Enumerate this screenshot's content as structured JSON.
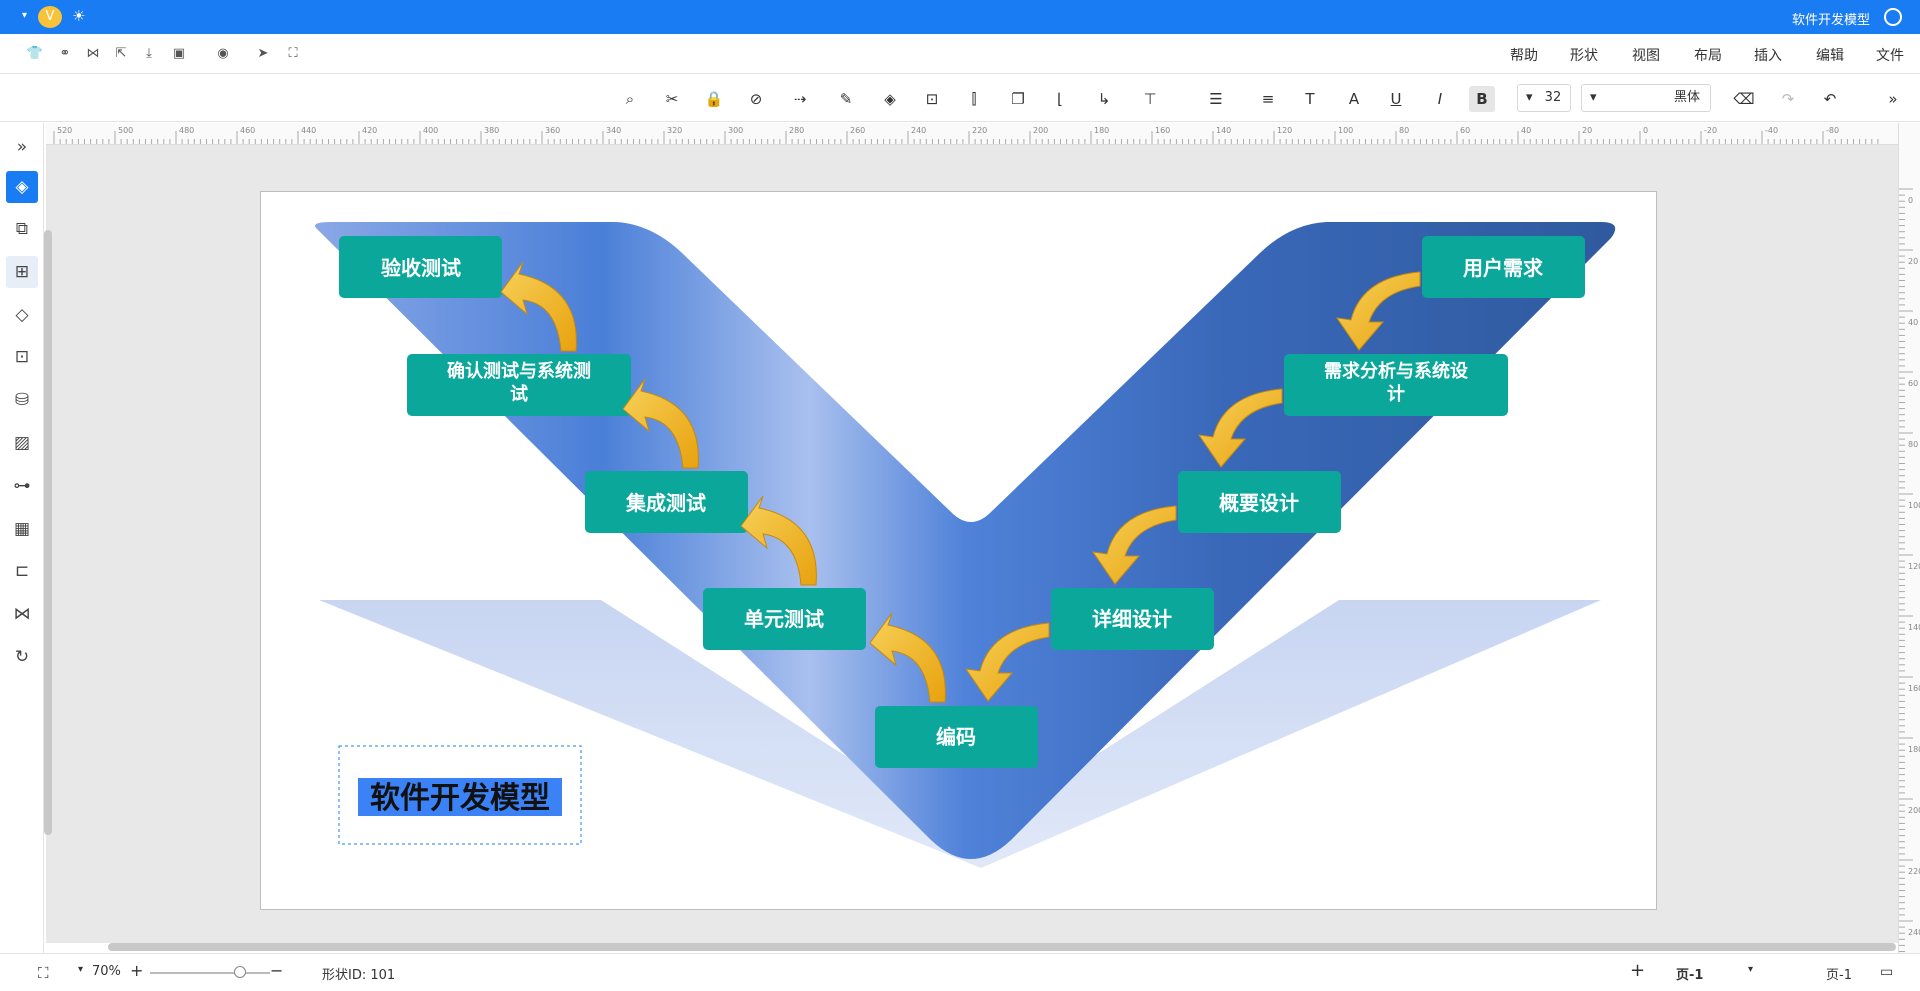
{
  "app": {
    "title": "软件开发模型",
    "brand_color": "#1a7cf2",
    "version_badge": "V"
  },
  "menu": {
    "items": [
      "文件",
      "编辑",
      "插入",
      "布局",
      "视图",
      "形状",
      "帮助"
    ]
  },
  "toolbar": {
    "font_name": "黑体",
    "font_size": "32",
    "bold_label": "B",
    "italic_label": "I",
    "underline_label": "U",
    "text_label": "T"
  },
  "ruler": {
    "top_labels": [
      "520",
      "500",
      "480",
      "460",
      "440",
      "420",
      "400",
      "380",
      "360",
      "340",
      "320",
      "300",
      "280",
      "260",
      "240",
      "220",
      "200",
      "180",
      "160",
      "140",
      "120",
      "100",
      "80",
      "60",
      "40",
      "20",
      "0",
      "-20",
      "-40",
      "-80"
    ],
    "right_labels": [
      "0",
      "20",
      "40",
      "60",
      "80",
      "100",
      "120",
      "140",
      "160",
      "180",
      "200",
      "220",
      "240"
    ]
  },
  "diagram": {
    "caption": "软件开发模型",
    "left_steps": [
      "验收测试",
      "确认测试与系统测试",
      "集成测试",
      "单元测试"
    ],
    "right_steps": [
      "用户需求",
      "需求分析与系统设计",
      "概要设计",
      "详细设计"
    ],
    "bottom_step": "编码",
    "box_color": "#0aa79a",
    "arrow_color": "#f2b21b",
    "v_color_dark": "#2f5a9e",
    "v_color_light": "#9fb8ea"
  },
  "status": {
    "page_tab": "页-1",
    "page_tab_active": "页-1",
    "shape_id": "形状ID: 101",
    "zoom": "70%"
  }
}
